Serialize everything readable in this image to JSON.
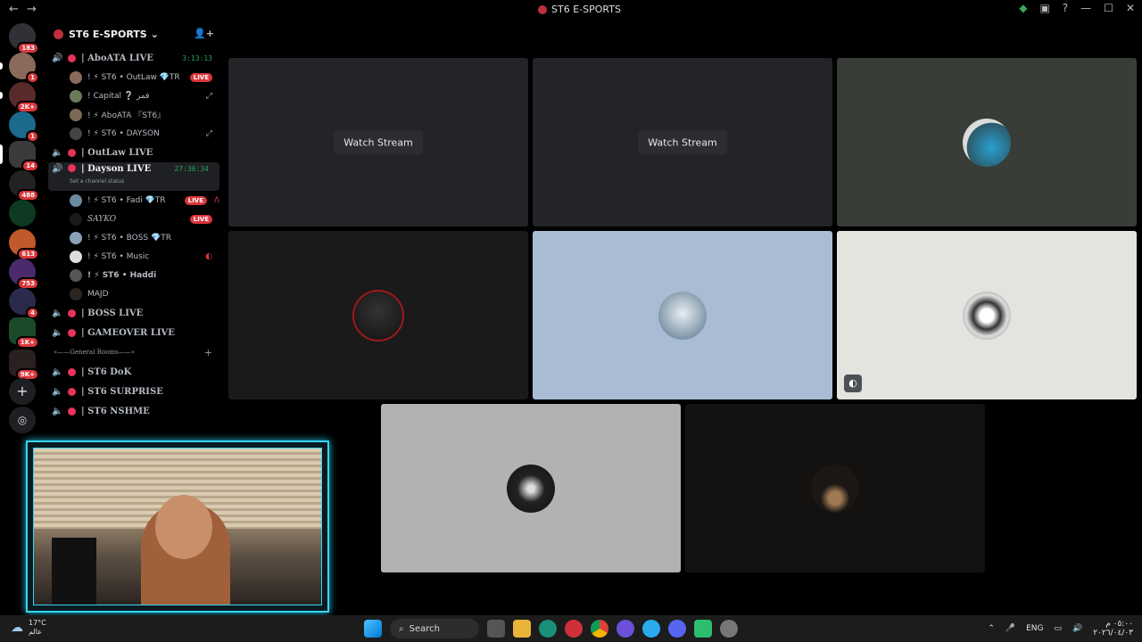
{
  "window": {
    "title": "ST6 E-SPORTS"
  },
  "guild_badges": [
    "183",
    "1",
    "2K+",
    "1",
    "14",
    "488",
    "",
    "613",
    "753",
    "4",
    "1K+",
    "9K+"
  ],
  "server": {
    "name": "ST6 E-SPORTS"
  },
  "channels": [
    {
      "name": "| AboATA LIVE",
      "timer": "3:13:13",
      "speaker": "on"
    },
    {
      "name": "| OutLaw LIVE",
      "timer": "",
      "speaker": "off"
    },
    {
      "name": "| Dayson LIVE",
      "timer": "27:36:34",
      "speaker": "on",
      "status": "Set a channel status"
    },
    {
      "name": "| BOSS LIVE",
      "timer": "",
      "speaker": "off"
    },
    {
      "name": "| GAMEOVER LIVE",
      "timer": "",
      "speaker": "off"
    },
    {
      "name": "| ST6 DoK",
      "timer": "",
      "speaker": "off"
    },
    {
      "name": "| ST6 SURPRISE",
      "timer": "",
      "speaker": "off"
    },
    {
      "name": "| ST6 NSHME",
      "timer": "",
      "speaker": "off"
    }
  ],
  "users_aboata": [
    {
      "name": "! ⚡ ST6 • OutLaw  💎TR",
      "live": "LIVE"
    },
    {
      "name": "! Capital  ❔ قمر",
      "icon": "⤢"
    },
    {
      "name": "! ⚡ AboATA 『ST6』"
    },
    {
      "name": "! ⚡ ST6 • DAYSON",
      "icon": "⤢"
    }
  ],
  "users_dayson": [
    {
      "name": "! ⚡ ST6 • Fadi  💎TR",
      "live": "LIVE"
    },
    {
      "name": "SAYKO",
      "live": "LIVE"
    },
    {
      "name": "! ⚡ ST6 • BOSS  💎TR"
    },
    {
      "name": "! ⚡ ST6 • Music"
    },
    {
      "name": "! ⚡ ST6 • Haddi"
    },
    {
      "name": "MAJD"
    }
  ],
  "category": {
    "label": "«——General Rooms——»"
  },
  "tiles": {
    "watch_label": "Watch Stream"
  },
  "taskbar": {
    "search": "Search",
    "temp": "17°C",
    "weather_text": "عالم",
    "lang": "ENG",
    "time": "٠٥:٠٠ م",
    "date": "٢٠٢٦/٠٤/٠٣"
  }
}
